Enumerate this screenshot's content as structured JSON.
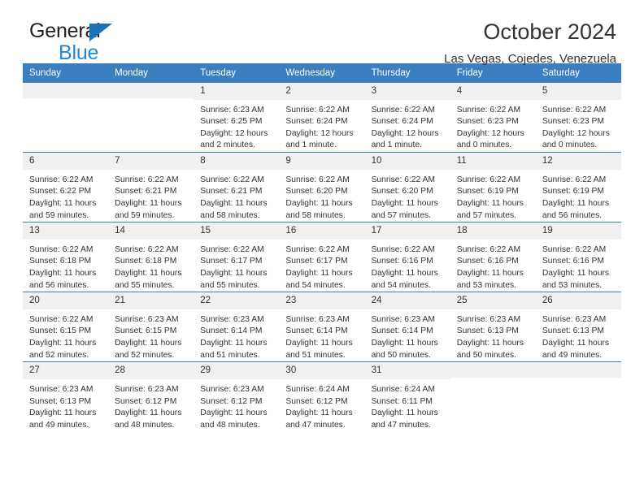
{
  "brand": {
    "name_top": "General",
    "name_bottom": "Blue",
    "logo_icon": "triangle-logo-icon",
    "color_dark": "#231f20",
    "color_blue": "#1f87d8"
  },
  "header": {
    "title": "October 2024",
    "subtitle": "Las Vegas, Cojedes, Venezuela"
  },
  "theme": {
    "header_row_bg": "#3c7fc0",
    "header_row_text": "#ffffff",
    "daynum_bg": "#f0f0f0",
    "grid_line": "#3c7fc0",
    "body_text": "#333333"
  },
  "labels": {
    "sunrise_prefix": "Sunrise:",
    "sunset_prefix": "Sunset:",
    "daylight_prefix": "Daylight:"
  },
  "weekdays": [
    "Sunday",
    "Monday",
    "Tuesday",
    "Wednesday",
    "Thursday",
    "Friday",
    "Saturday"
  ],
  "weeks": [
    [
      {
        "day": "",
        "blank": true
      },
      {
        "day": "",
        "blank": true
      },
      {
        "day": "1",
        "sunrise": "Sunrise: 6:23 AM",
        "sunset": "Sunset: 6:25 PM",
        "daylight": "Daylight: 12 hours and 2 minutes."
      },
      {
        "day": "2",
        "sunrise": "Sunrise: 6:22 AM",
        "sunset": "Sunset: 6:24 PM",
        "daylight": "Daylight: 12 hours and 1 minute."
      },
      {
        "day": "3",
        "sunrise": "Sunrise: 6:22 AM",
        "sunset": "Sunset: 6:24 PM",
        "daylight": "Daylight: 12 hours and 1 minute."
      },
      {
        "day": "4",
        "sunrise": "Sunrise: 6:22 AM",
        "sunset": "Sunset: 6:23 PM",
        "daylight": "Daylight: 12 hours and 0 minutes."
      },
      {
        "day": "5",
        "sunrise": "Sunrise: 6:22 AM",
        "sunset": "Sunset: 6:23 PM",
        "daylight": "Daylight: 12 hours and 0 minutes."
      }
    ],
    [
      {
        "day": "6",
        "sunrise": "Sunrise: 6:22 AM",
        "sunset": "Sunset: 6:22 PM",
        "daylight": "Daylight: 11 hours and 59 minutes."
      },
      {
        "day": "7",
        "sunrise": "Sunrise: 6:22 AM",
        "sunset": "Sunset: 6:21 PM",
        "daylight": "Daylight: 11 hours and 59 minutes."
      },
      {
        "day": "8",
        "sunrise": "Sunrise: 6:22 AM",
        "sunset": "Sunset: 6:21 PM",
        "daylight": "Daylight: 11 hours and 58 minutes."
      },
      {
        "day": "9",
        "sunrise": "Sunrise: 6:22 AM",
        "sunset": "Sunset: 6:20 PM",
        "daylight": "Daylight: 11 hours and 58 minutes."
      },
      {
        "day": "10",
        "sunrise": "Sunrise: 6:22 AM",
        "sunset": "Sunset: 6:20 PM",
        "daylight": "Daylight: 11 hours and 57 minutes."
      },
      {
        "day": "11",
        "sunrise": "Sunrise: 6:22 AM",
        "sunset": "Sunset: 6:19 PM",
        "daylight": "Daylight: 11 hours and 57 minutes."
      },
      {
        "day": "12",
        "sunrise": "Sunrise: 6:22 AM",
        "sunset": "Sunset: 6:19 PM",
        "daylight": "Daylight: 11 hours and 56 minutes."
      }
    ],
    [
      {
        "day": "13",
        "sunrise": "Sunrise: 6:22 AM",
        "sunset": "Sunset: 6:18 PM",
        "daylight": "Daylight: 11 hours and 56 minutes."
      },
      {
        "day": "14",
        "sunrise": "Sunrise: 6:22 AM",
        "sunset": "Sunset: 6:18 PM",
        "daylight": "Daylight: 11 hours and 55 minutes."
      },
      {
        "day": "15",
        "sunrise": "Sunrise: 6:22 AM",
        "sunset": "Sunset: 6:17 PM",
        "daylight": "Daylight: 11 hours and 55 minutes."
      },
      {
        "day": "16",
        "sunrise": "Sunrise: 6:22 AM",
        "sunset": "Sunset: 6:17 PM",
        "daylight": "Daylight: 11 hours and 54 minutes."
      },
      {
        "day": "17",
        "sunrise": "Sunrise: 6:22 AM",
        "sunset": "Sunset: 6:16 PM",
        "daylight": "Daylight: 11 hours and 54 minutes."
      },
      {
        "day": "18",
        "sunrise": "Sunrise: 6:22 AM",
        "sunset": "Sunset: 6:16 PM",
        "daylight": "Daylight: 11 hours and 53 minutes."
      },
      {
        "day": "19",
        "sunrise": "Sunrise: 6:22 AM",
        "sunset": "Sunset: 6:16 PM",
        "daylight": "Daylight: 11 hours and 53 minutes."
      }
    ],
    [
      {
        "day": "20",
        "sunrise": "Sunrise: 6:22 AM",
        "sunset": "Sunset: 6:15 PM",
        "daylight": "Daylight: 11 hours and 52 minutes."
      },
      {
        "day": "21",
        "sunrise": "Sunrise: 6:23 AM",
        "sunset": "Sunset: 6:15 PM",
        "daylight": "Daylight: 11 hours and 52 minutes."
      },
      {
        "day": "22",
        "sunrise": "Sunrise: 6:23 AM",
        "sunset": "Sunset: 6:14 PM",
        "daylight": "Daylight: 11 hours and 51 minutes."
      },
      {
        "day": "23",
        "sunrise": "Sunrise: 6:23 AM",
        "sunset": "Sunset: 6:14 PM",
        "daylight": "Daylight: 11 hours and 51 minutes."
      },
      {
        "day": "24",
        "sunrise": "Sunrise: 6:23 AM",
        "sunset": "Sunset: 6:14 PM",
        "daylight": "Daylight: 11 hours and 50 minutes."
      },
      {
        "day": "25",
        "sunrise": "Sunrise: 6:23 AM",
        "sunset": "Sunset: 6:13 PM",
        "daylight": "Daylight: 11 hours and 50 minutes."
      },
      {
        "day": "26",
        "sunrise": "Sunrise: 6:23 AM",
        "sunset": "Sunset: 6:13 PM",
        "daylight": "Daylight: 11 hours and 49 minutes."
      }
    ],
    [
      {
        "day": "27",
        "sunrise": "Sunrise: 6:23 AM",
        "sunset": "Sunset: 6:13 PM",
        "daylight": "Daylight: 11 hours and 49 minutes."
      },
      {
        "day": "28",
        "sunrise": "Sunrise: 6:23 AM",
        "sunset": "Sunset: 6:12 PM",
        "daylight": "Daylight: 11 hours and 48 minutes."
      },
      {
        "day": "29",
        "sunrise": "Sunrise: 6:23 AM",
        "sunset": "Sunset: 6:12 PM",
        "daylight": "Daylight: 11 hours and 48 minutes."
      },
      {
        "day": "30",
        "sunrise": "Sunrise: 6:24 AM",
        "sunset": "Sunset: 6:12 PM",
        "daylight": "Daylight: 11 hours and 47 minutes."
      },
      {
        "day": "31",
        "sunrise": "Sunrise: 6:24 AM",
        "sunset": "Sunset: 6:11 PM",
        "daylight": "Daylight: 11 hours and 47 minutes."
      },
      {
        "day": "",
        "blank": true
      },
      {
        "day": "",
        "blank": true
      }
    ]
  ]
}
